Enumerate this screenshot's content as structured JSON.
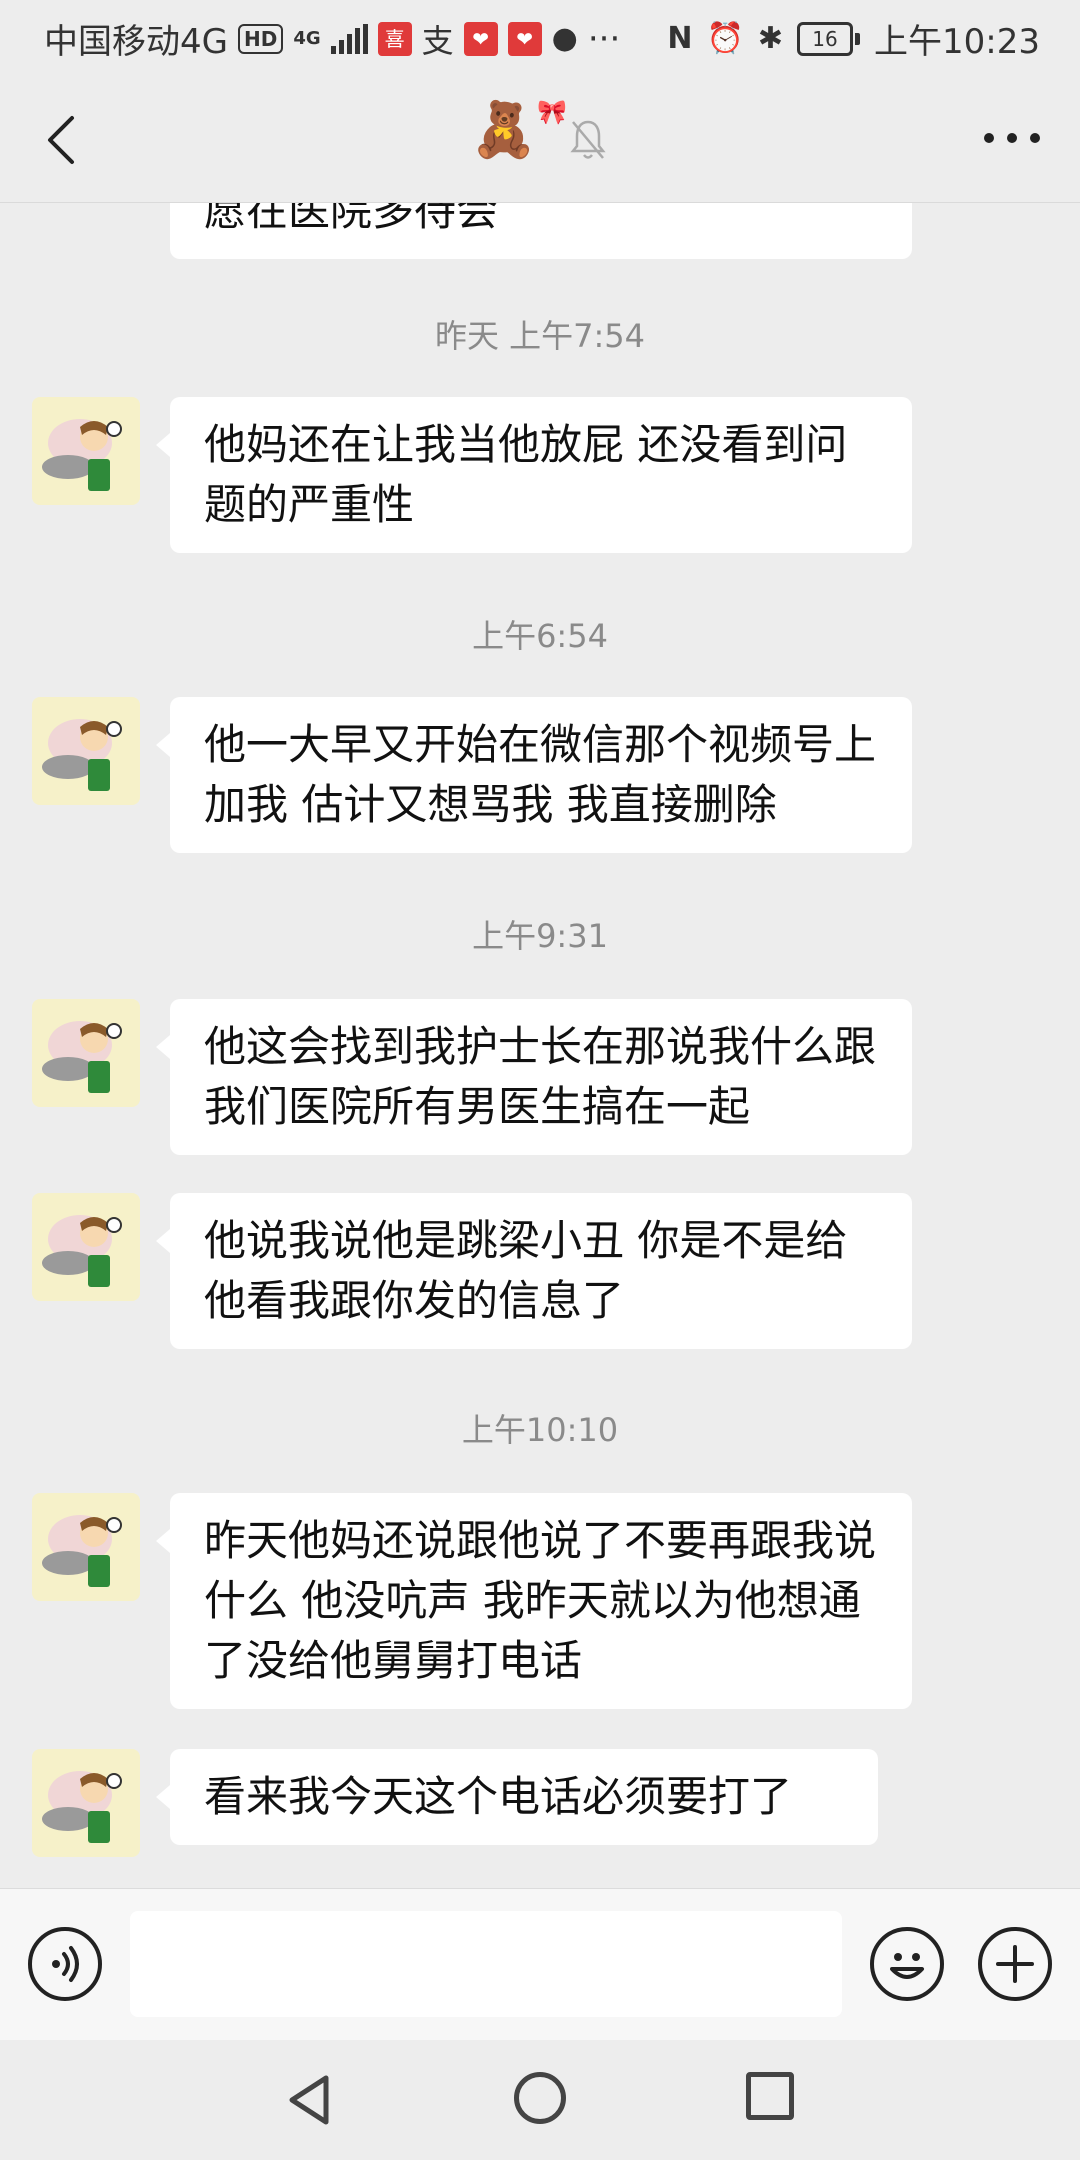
{
  "status_bar": {
    "carrier": "中国移动4G",
    "hd_label": "HD",
    "network_label": "4G",
    "battery_level": "16",
    "time": "上午10:23"
  },
  "header": {
    "title_emoji": "🧸",
    "back_icon": "chevron-left-icon",
    "mute_icon": "bell-mute-icon",
    "more_icon": "more-dots-icon"
  },
  "messages": {
    "m0": "愿在医院多待会",
    "t1": "昨天 上午7:54",
    "m1": "他妈还在让我当他放屁 还没看到问题的严重性",
    "t2": "上午6:54",
    "m2": "他一大早又开始在微信那个视频号上加我 估计又想骂我 我直接删除",
    "t3": "上午9:31",
    "m3": "他这会找到我护士长在那说我什么跟我们医院所有男医生搞在一起",
    "m4": "他说我说他是跳梁小丑 你是不是给他看我跟你发的信息了",
    "t4": "上午10:10",
    "m5": "昨天他妈还说跟他说了不要再跟我说什么 他没吭声 我昨天就以为他想通了没给他舅舅打电话",
    "m6": "看来我今天这个电话必须要打了"
  },
  "input": {
    "value": "",
    "voice_icon": "voice-icon",
    "emoji_icon": "emoji-icon",
    "plus_icon": "plus-icon"
  },
  "navbar": {
    "back_icon": "nav-back-icon",
    "home_icon": "nav-home-icon",
    "recent_icon": "nav-recent-icon"
  }
}
